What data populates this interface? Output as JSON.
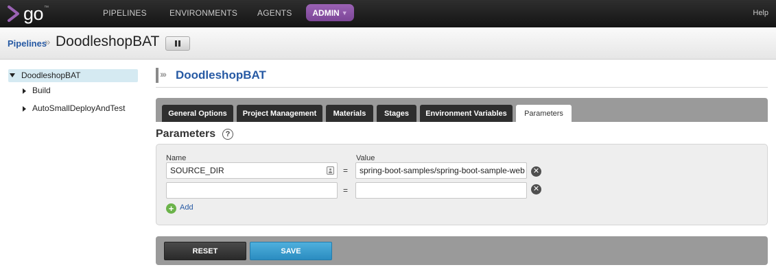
{
  "app": {
    "logo_text": "go",
    "logo_mark": "™"
  },
  "nav": {
    "items": [
      {
        "label": "PIPELINES"
      },
      {
        "label": "ENVIRONMENTS"
      },
      {
        "label": "AGENTS"
      }
    ],
    "admin_label": "ADMIN",
    "admin_caret": "▼",
    "help_label": "Help"
  },
  "breadcrumb": {
    "link": "Pipelines",
    "separator": "»",
    "title": "DoodleshopBAT"
  },
  "tree": {
    "root": "DoodleshopBAT",
    "children": [
      {
        "label": "Build"
      },
      {
        "label": "AutoSmallDeployAndTest"
      }
    ]
  },
  "main": {
    "title": "DoodleshopBAT",
    "title_arrows": "›››",
    "tabs": [
      {
        "label": "General Options"
      },
      {
        "label": "Project Management"
      },
      {
        "label": "Materials"
      },
      {
        "label": "Stages"
      },
      {
        "label": "Environment Variables"
      },
      {
        "label": "Parameters"
      }
    ],
    "active_tab": "Parameters"
  },
  "parameters": {
    "heading": "Parameters",
    "help_glyph": "?",
    "name_header": "Name",
    "value_header": "Value",
    "equals": "=",
    "rows": [
      {
        "name": "SOURCE_DIR",
        "value": "spring-boot-samples/spring-boot-sample-web"
      },
      {
        "name": "",
        "value": ""
      }
    ],
    "remove_glyph": "✕",
    "add_glyph": "+",
    "add_label": "Add"
  },
  "actions": {
    "reset_label": "RESET",
    "save_label": "SAVE"
  },
  "colors": {
    "brand_purple": "#7c4597",
    "link_blue": "#2659a3",
    "save_blue": "#2b8cc0",
    "add_green": "#6bb34a"
  },
  "icons": [
    "go-logo-icon",
    "pause-icon",
    "tree-expanded-icon",
    "tree-collapsed-icon",
    "pipeline-arrows-icon",
    "help-icon",
    "contact-card-icon",
    "remove-icon",
    "add-icon"
  ]
}
